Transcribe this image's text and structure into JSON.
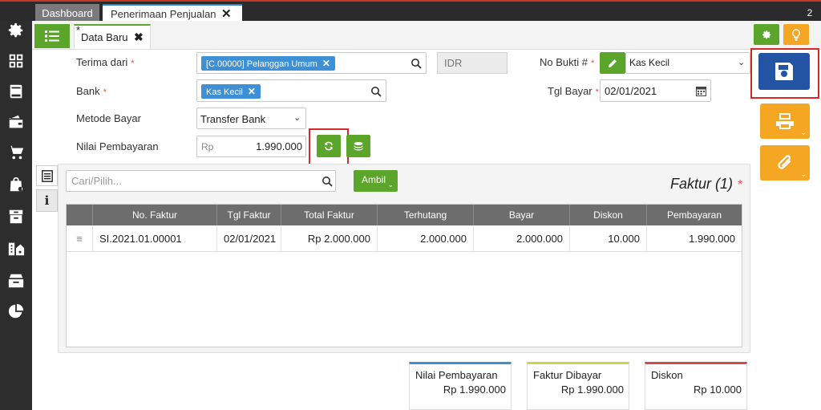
{
  "tabs": {
    "dashboard": "Dashboard",
    "active": "Penerimaan Penjualan",
    "count": "2"
  },
  "doc_tab": {
    "modified_mark": "*",
    "label": "Data Baru",
    "close": "✖"
  },
  "form": {
    "terima_dari_label": "Terima dari",
    "terima_dari_value": "[C.00000] Pelanggan Umum",
    "currency": "IDR",
    "no_bukti_label": "No Bukti #",
    "no_bukti_value": "Kas Kecil",
    "bank_label": "Bank",
    "bank_value": "Kas Kecil",
    "tgl_bayar_label": "Tgl Bayar",
    "tgl_bayar_value": "02/01/2021",
    "metode_label": "Metode Bayar",
    "metode_value": "Transfer Bank",
    "nilai_label": "Nilai Pembayaran",
    "nilai_prefix": "Rp",
    "nilai_value": "1.990.000",
    "required_mark": "*"
  },
  "grid": {
    "search_placeholder": "Cari/Pilih...",
    "ambil_label": "Ambil",
    "title": "Faktur (1)",
    "columns": [
      "No. Faktur",
      "Tgl Faktur",
      "Total Faktur",
      "Terhutang",
      "Bayar",
      "Diskon",
      "Pembayaran"
    ],
    "rows": [
      {
        "no": "SI.2021.01.00001",
        "tgl": "02/01/2021",
        "total": "Rp 2.000.000",
        "terhutang": "2.000.000",
        "bayar": "2.000.000",
        "diskon": "10.000",
        "pembayaran": "1.990.000"
      }
    ]
  },
  "summary": {
    "nilai_label": "Nilai Pembayaran",
    "nilai_value": "Rp 1.990.000",
    "faktur_label": "Faktur Dibayar",
    "faktur_value": "Rp 1.990.000",
    "diskon_label": "Diskon",
    "diskon_value": "Rp 10.000"
  },
  "colors": {
    "green": "#5aa52a",
    "blue": "#2455a4",
    "orange": "#f5a623",
    "highlight": "#d62a2a",
    "chip": "#3d8fd6"
  },
  "icons": {
    "sidebar": [
      "settings-icon",
      "apps-icon",
      "book-icon",
      "wallet-icon",
      "cart-icon",
      "bag-icon",
      "archive-icon",
      "building-icon",
      "tax-icon",
      "pie-chart-icon"
    ]
  }
}
